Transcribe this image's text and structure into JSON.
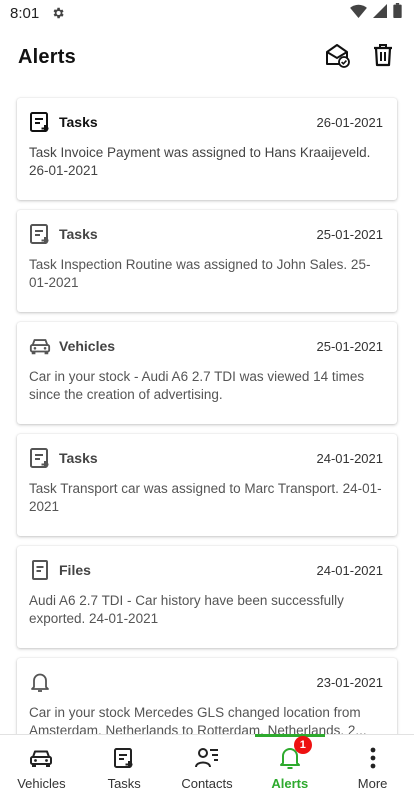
{
  "status_bar": {
    "time": "8:01"
  },
  "header": {
    "title": "Alerts"
  },
  "alerts": [
    {
      "category": "Tasks",
      "icon": "task-add-icon",
      "date": "26-01-2021",
      "text": "Task Invoice Payment was assigned to Hans Kraaijeveld. 26-01-2021",
      "unread": true
    },
    {
      "category": "Tasks",
      "icon": "task-add-icon",
      "date": "25-01-2021",
      "text": "Task Inspection Routine was assigned to John Sales. 25-01-2021",
      "unread": false
    },
    {
      "category": "Vehicles",
      "icon": "car-icon",
      "date": "25-01-2021",
      "text": "Car in your stock - Audi A6 2.7 TDI was viewed 14 times since the creation of advertising.",
      "unread": false
    },
    {
      "category": "Tasks",
      "icon": "task-add-icon",
      "date": "24-01-2021",
      "text": "Task Transport car was assigned to Marc Transport. 24-01-2021",
      "unread": false
    },
    {
      "category": "Files",
      "icon": "file-icon",
      "date": "24-01-2021",
      "text": "Audi A6 2.7 TDI - Car history have been successfully exported. 24-01-2021",
      "unread": false
    },
    {
      "category": "",
      "icon": "bell-icon",
      "date": "23-01-2021",
      "text": "Car in your stock Mercedes GLS changed location from Amsterdam, Netherlands to Rotterdam, Netherlands. 2...",
      "unread": false
    }
  ],
  "bottom_nav": {
    "items": [
      {
        "label": "Vehicles",
        "icon": "car-icon"
      },
      {
        "label": "Tasks",
        "icon": "task-add-icon"
      },
      {
        "label": "Contacts",
        "icon": "contacts-icon"
      },
      {
        "label": "Alerts",
        "icon": "bell-icon",
        "badge": "1",
        "active": true
      },
      {
        "label": "More",
        "icon": "more-vertical-icon"
      }
    ]
  },
  "colors": {
    "accent": "#2eaa2e",
    "badge": "#ee1111"
  }
}
